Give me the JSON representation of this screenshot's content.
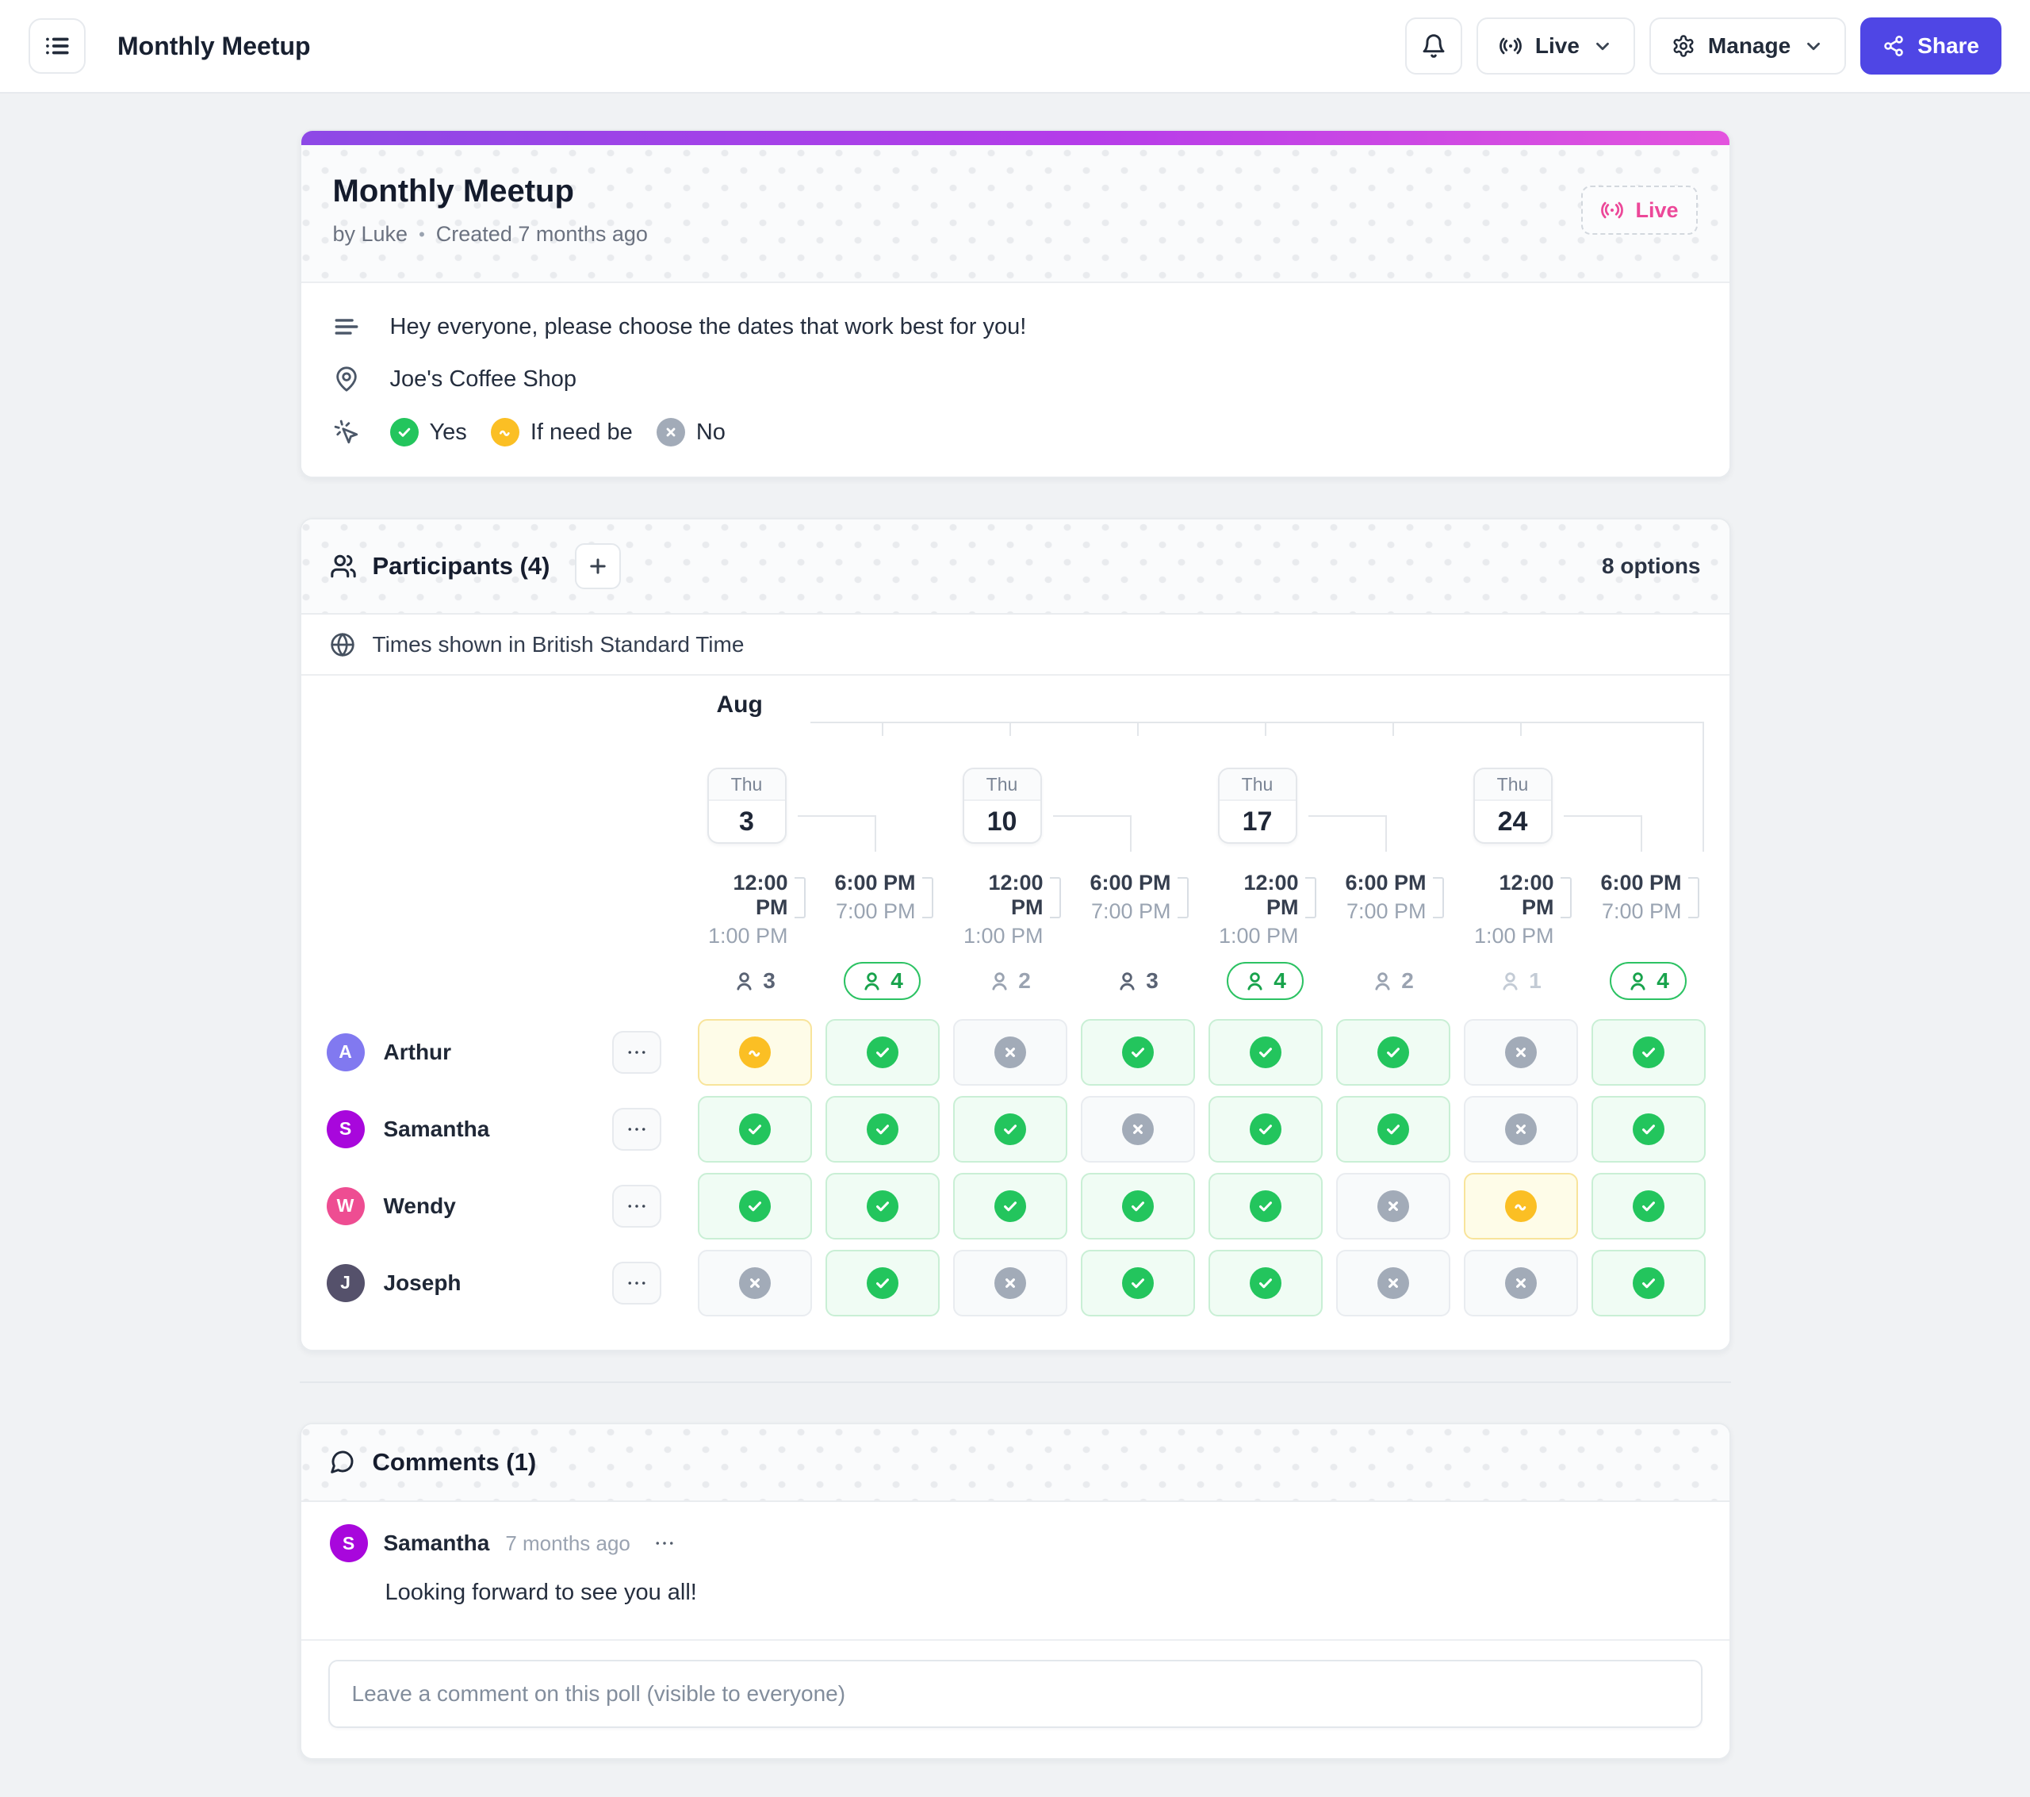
{
  "topbar": {
    "title": "Monthly Meetup",
    "live_label": "Live",
    "manage_label": "Manage",
    "share_label": "Share"
  },
  "poll": {
    "title": "Monthly Meetup",
    "by": "by Luke",
    "separator": "•",
    "created": "Created 7 months ago",
    "live_badge": "Live",
    "description": "Hey everyone, please choose the dates that work best for you!",
    "location": "Joe's Coffee Shop",
    "legend": [
      {
        "type": "yes",
        "label": "Yes"
      },
      {
        "type": "ifNeedBe",
        "label": "If need be"
      },
      {
        "type": "no",
        "label": "No"
      }
    ]
  },
  "participants_section": {
    "title": "Participants (4)",
    "options_label": "8 options",
    "timezone_note": "Times shown in British Standard Time",
    "month_label": "Aug",
    "dates": [
      {
        "dow": "Thu",
        "day": "3"
      },
      {
        "dow": "Thu",
        "day": "10"
      },
      {
        "dow": "Thu",
        "day": "17"
      },
      {
        "dow": "Thu",
        "day": "24"
      }
    ],
    "slots": [
      {
        "start": "12:00 PM",
        "end": "1:00 PM",
        "count": 3
      },
      {
        "start": "6:00 PM",
        "end": "7:00 PM",
        "count": 4
      },
      {
        "start": "12:00 PM",
        "end": "1:00 PM",
        "count": 2
      },
      {
        "start": "6:00 PM",
        "end": "7:00 PM",
        "count": 3
      },
      {
        "start": "12:00 PM",
        "end": "1:00 PM",
        "count": 4
      },
      {
        "start": "6:00 PM",
        "end": "7:00 PM",
        "count": 2
      },
      {
        "start": "12:00 PM",
        "end": "1:00 PM",
        "count": 1
      },
      {
        "start": "6:00 PM",
        "end": "7:00 PM",
        "count": 4
      }
    ],
    "participants": [
      {
        "name": "Arthur",
        "initial": "A",
        "color": "#8179f0",
        "votes": [
          "ifNeedBe",
          "yes",
          "no",
          "yes",
          "yes",
          "yes",
          "no",
          "yes"
        ]
      },
      {
        "name": "Samantha",
        "initial": "S",
        "color": "#a807dc",
        "votes": [
          "yes",
          "yes",
          "yes",
          "no",
          "yes",
          "yes",
          "no",
          "yes"
        ]
      },
      {
        "name": "Wendy",
        "initial": "W",
        "color": "#ee4d92",
        "votes": [
          "yes",
          "yes",
          "yes",
          "yes",
          "yes",
          "no",
          "ifNeedBe",
          "yes"
        ]
      },
      {
        "name": "Joseph",
        "initial": "J",
        "color": "#55516b",
        "votes": [
          "no",
          "yes",
          "no",
          "yes",
          "yes",
          "no",
          "no",
          "yes"
        ]
      }
    ]
  },
  "comments_section": {
    "title": "Comments (1)",
    "items": [
      {
        "author": "Samantha",
        "initial": "S",
        "color": "#a807dc",
        "time": "7 months ago",
        "text": "Looking forward to see you all!"
      }
    ],
    "input_placeholder": "Leave a comment on this poll (visible to everyone)"
  },
  "colors": {
    "accent": "#4f46e5",
    "live_pink": "#ec4899",
    "yes_green": "#23c55d",
    "if_need_be_amber": "#fbbf24",
    "no_gray": "#a2abb8",
    "gradient_start": "#8d49e6",
    "gradient_end": "#e354de"
  }
}
